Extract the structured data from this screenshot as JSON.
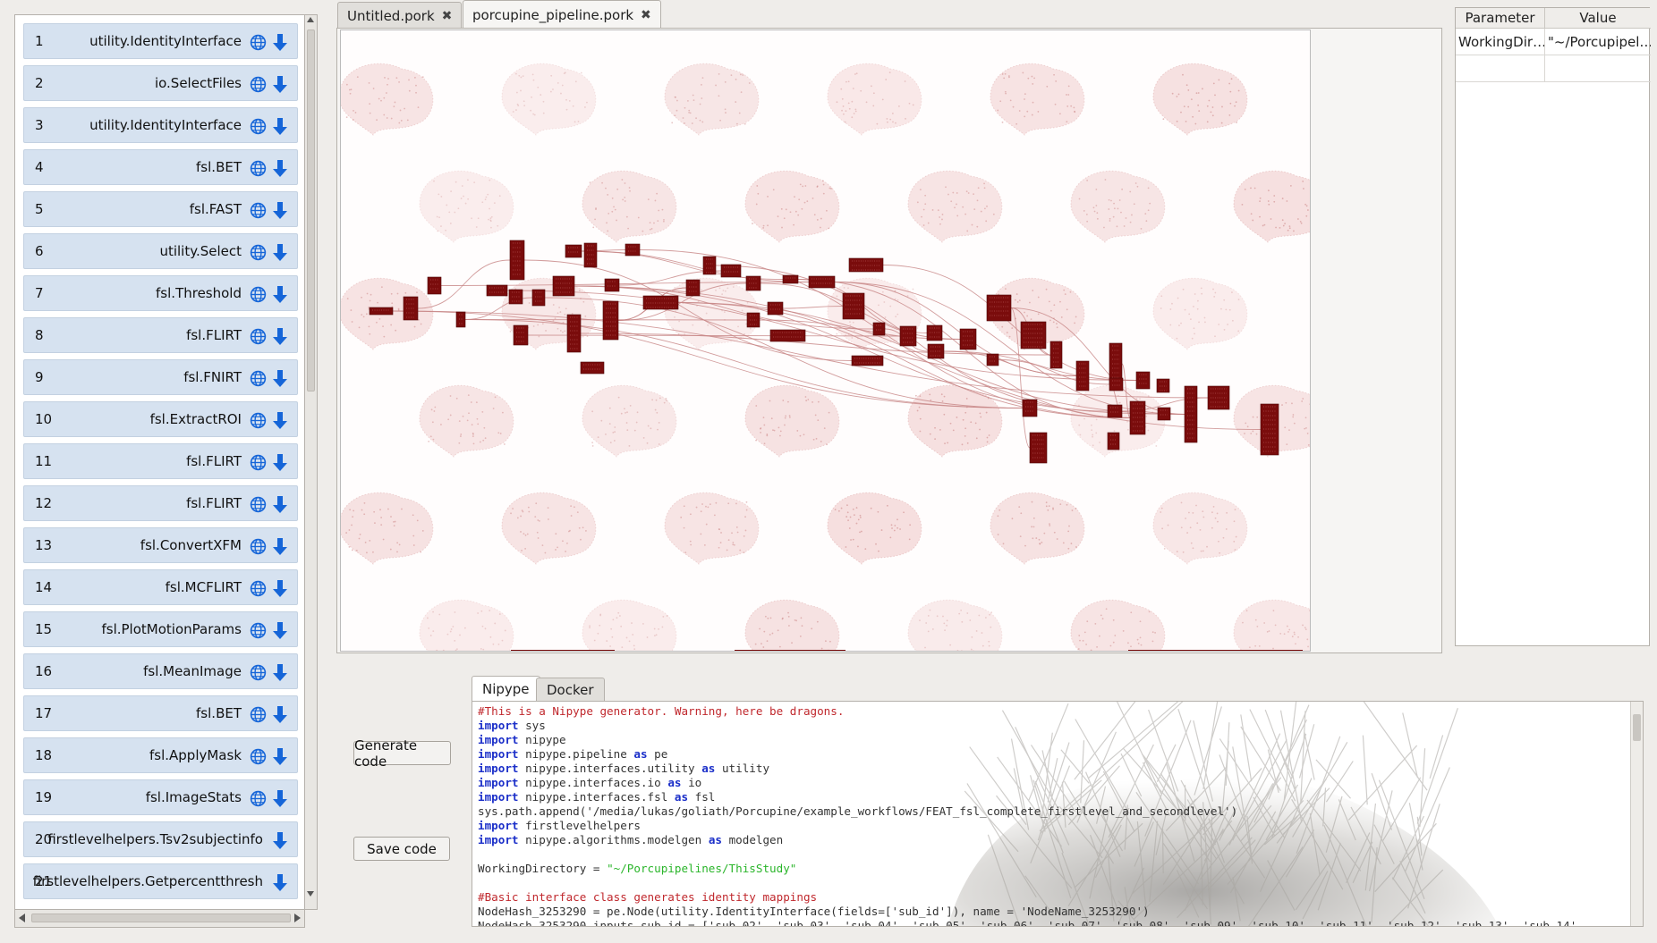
{
  "node_list": [
    {
      "index": "1",
      "name": "utility.IdentityInterface",
      "has_doc": true
    },
    {
      "index": "2",
      "name": "io.SelectFiles",
      "has_doc": true
    },
    {
      "index": "3",
      "name": "utility.IdentityInterface",
      "has_doc": true
    },
    {
      "index": "4",
      "name": "fsl.BET",
      "has_doc": true
    },
    {
      "index": "5",
      "name": "fsl.FAST",
      "has_doc": true
    },
    {
      "index": "6",
      "name": "utility.Select",
      "has_doc": true
    },
    {
      "index": "7",
      "name": "fsl.Threshold",
      "has_doc": true
    },
    {
      "index": "8",
      "name": "fsl.FLIRT",
      "has_doc": true
    },
    {
      "index": "9",
      "name": "fsl.FNIRT",
      "has_doc": true
    },
    {
      "index": "10",
      "name": "fsl.ExtractROI",
      "has_doc": true
    },
    {
      "index": "11",
      "name": "fsl.FLIRT",
      "has_doc": true
    },
    {
      "index": "12",
      "name": "fsl.FLIRT",
      "has_doc": true
    },
    {
      "index": "13",
      "name": "fsl.ConvertXFM",
      "has_doc": true
    },
    {
      "index": "14",
      "name": "fsl.MCFLIRT",
      "has_doc": true
    },
    {
      "index": "15",
      "name": "fsl.PlotMotionParams",
      "has_doc": true
    },
    {
      "index": "16",
      "name": "fsl.MeanImage",
      "has_doc": true
    },
    {
      "index": "17",
      "name": "fsl.BET",
      "has_doc": true
    },
    {
      "index": "18",
      "name": "fsl.ApplyMask",
      "has_doc": true
    },
    {
      "index": "19",
      "name": "fsl.ImageStats",
      "has_doc": true
    },
    {
      "index": "20",
      "name": "firstlevelhelpers.Tsv2subjectinfo",
      "has_doc": false
    },
    {
      "index": "21",
      "name": "firstlevelhelpers.Getpercentthresh",
      "has_doc": false
    }
  ],
  "file_tabs": [
    {
      "label": "Untitled.pork",
      "active": false
    },
    {
      "label": "porcupine_pipeline.pork",
      "active": true
    }
  ],
  "close_glyph": "✖",
  "parameters": {
    "headers": [
      "Parameter",
      "Value"
    ],
    "rows": [
      {
        "parameter": "WorkingDir…",
        "value": "\"~/Porcupipel…"
      }
    ]
  },
  "buttons": {
    "generate": "Generate code",
    "save": "Save code"
  },
  "code_tabs": [
    {
      "label": "Nipype",
      "active": true
    },
    {
      "label": "Docker",
      "active": false
    }
  ],
  "code": {
    "lines": [
      {
        "type": "comment",
        "text": "#This is a Nipype generator. Warning, here be dragons."
      },
      {
        "type": "import",
        "kw": "import",
        "rest": " sys"
      },
      {
        "type": "import",
        "kw": "import",
        "rest": " nipype"
      },
      {
        "type": "import_as",
        "kw": "import",
        "mod": " nipype.pipeline ",
        "as": "as",
        "alias": " pe"
      },
      {
        "type": "import_as",
        "kw": "import",
        "mod": " nipype.interfaces.utility ",
        "as": "as",
        "alias": " utility"
      },
      {
        "type": "import_as",
        "kw": "import",
        "mod": " nipype.interfaces.io ",
        "as": "as",
        "alias": " io"
      },
      {
        "type": "import_as",
        "kw": "import",
        "mod": " nipype.interfaces.fsl ",
        "as": "as",
        "alias": " fsl"
      },
      {
        "type": "plain",
        "text": "sys.path.append('/media/lukas/goliath/Porcupine/example_workflows/FEAT_fsl_complete_firstlevel_and_secondlevel')"
      },
      {
        "type": "import",
        "kw": "import",
        "rest": " firstlevelhelpers"
      },
      {
        "type": "import_as",
        "kw": "import",
        "mod": " nipype.algorithms.modelgen ",
        "as": "as",
        "alias": " modelgen"
      },
      {
        "type": "blank",
        "text": ""
      },
      {
        "type": "assign_str",
        "lhs": "WorkingDirectory = ",
        "str": "\"~/Porcupipelines/ThisStudy\""
      },
      {
        "type": "blank",
        "text": ""
      },
      {
        "type": "comment",
        "text": "#Basic interface class generates identity mappings"
      },
      {
        "type": "plain",
        "text": "NodeHash_3253290 = pe.Node(utility.IdentityInterface(fields=['sub_id']), name = 'NodeName_3253290')"
      },
      {
        "type": "plain",
        "text": "NodeHash_3253290.inputs.sub_id = ['sub-02', 'sub-03', 'sub-04', 'sub-05', 'sub-06', 'sub-07', 'sub-08', 'sub-09', 'sub-10', 'sub-11', 'sub-12', 'sub-13', 'sub-14'"
      }
    ]
  },
  "colors": {
    "node_fill": "#d6e2f0",
    "icon_blue": "#1565d8",
    "graph_node": "#7a0c0c",
    "graph_edge": "#c78585",
    "brain_dot": "#d9a0a0"
  }
}
